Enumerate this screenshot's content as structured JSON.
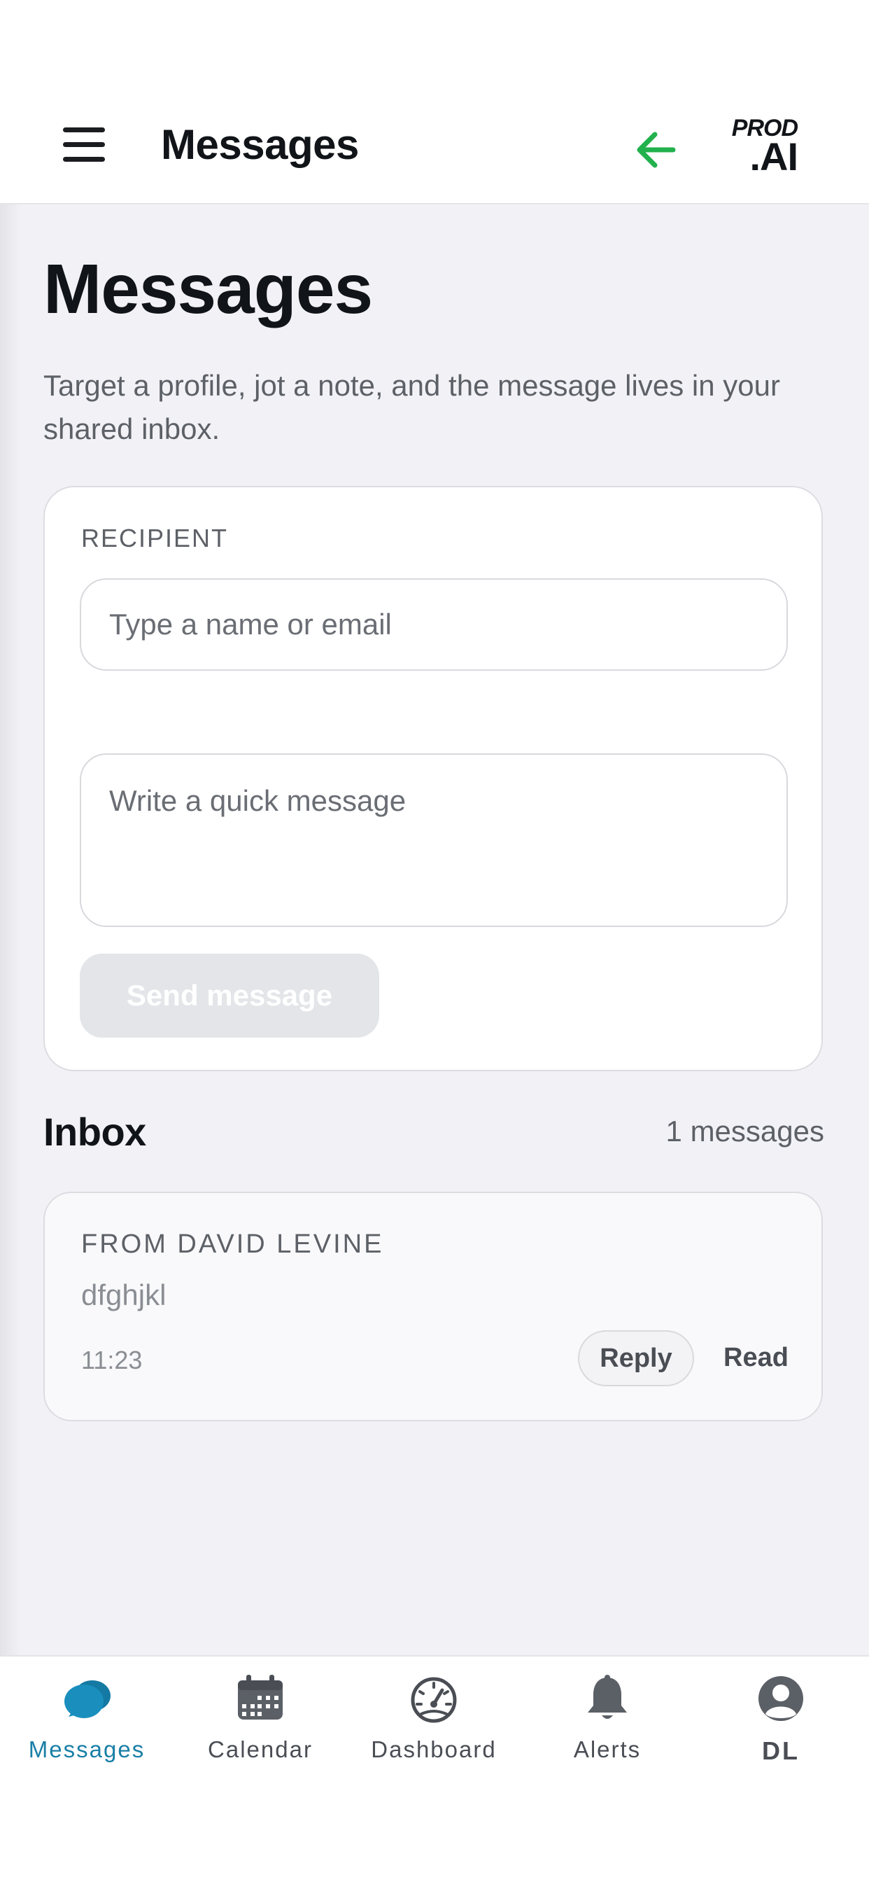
{
  "header": {
    "title": "Messages",
    "logo_line1": "PROD",
    "logo_line2": ".AI",
    "accent_color": "#22b14c"
  },
  "page": {
    "title": "Messages",
    "subtitle": "Target a profile, jot a note, and the message lives in your shared inbox."
  },
  "compose": {
    "recipient_label": "RECIPIENT",
    "recipient_placeholder": "Type a name or email",
    "message_placeholder": "Write a quick message",
    "send_label": "Send message"
  },
  "inbox": {
    "title": "Inbox",
    "count_label": "1 messages",
    "messages": [
      {
        "from": "FROM DAVID LEVINE",
        "text": "dfghjkl",
        "time": "11:23",
        "reply_label": "Reply",
        "read_label": "Read"
      }
    ]
  },
  "tabbar": {
    "active_color": "#1a7fa6",
    "tabs": [
      {
        "label": "Messages",
        "icon": "chat-bubbles-icon"
      },
      {
        "label": "Calendar",
        "icon": "calendar-icon"
      },
      {
        "label": "Dashboard",
        "icon": "speedometer-icon"
      },
      {
        "label": "Alerts",
        "icon": "bell-icon"
      },
      {
        "label": "DL",
        "icon": "user-avatar-icon"
      }
    ]
  }
}
